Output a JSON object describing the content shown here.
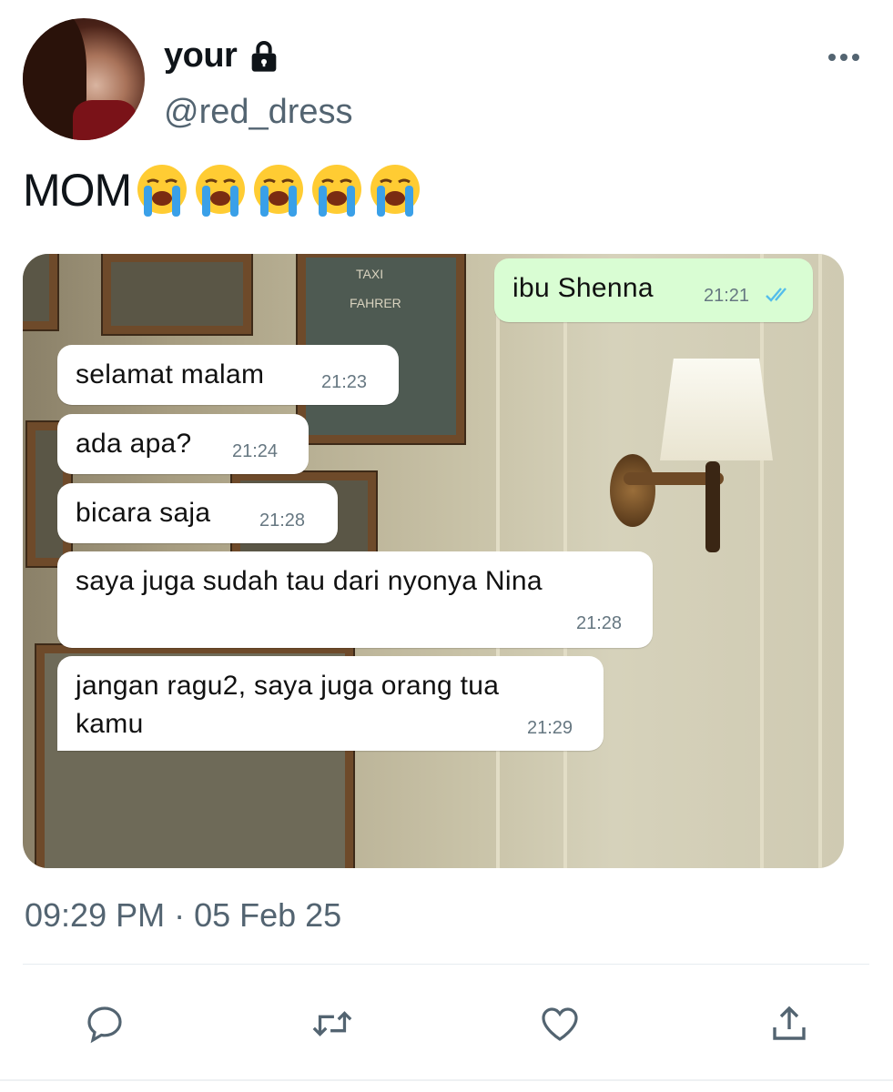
{
  "author": {
    "display_name": "your",
    "handle": "@red_dress",
    "protected_icon": "lock-icon"
  },
  "tweet": {
    "text": "MOM",
    "emoji": [
      "😭",
      "😭",
      "😭",
      "😭",
      "😭"
    ],
    "timestamp": "09:29 PM · 05 Feb 25"
  },
  "chat": {
    "outgoing": {
      "text": "ibu Shenna",
      "time": "21:21"
    },
    "incoming": [
      {
        "text": "selamat malam",
        "time": "21:23"
      },
      {
        "text": "ada apa?",
        "time": "21:24"
      },
      {
        "text": "bicara saja",
        "time": "21:28"
      },
      {
        "text": "saya juga sudah tau dari nyonya Nina",
        "time": "21:28"
      },
      {
        "text_line1": "jangan ragu2, saya juga orang tua",
        "text_line2": "kamu",
        "time": "21:29"
      }
    ],
    "image_text": {
      "sign1": "TAXI",
      "sign2": "FAHRER"
    }
  },
  "actions": [
    "reply-icon",
    "retweet-icon",
    "like-icon",
    "share-icon"
  ],
  "colors": {
    "secondary_text": "#536471",
    "outgoing_bubble": "#d9fdd3",
    "read_ticks": "#53bdeb"
  }
}
